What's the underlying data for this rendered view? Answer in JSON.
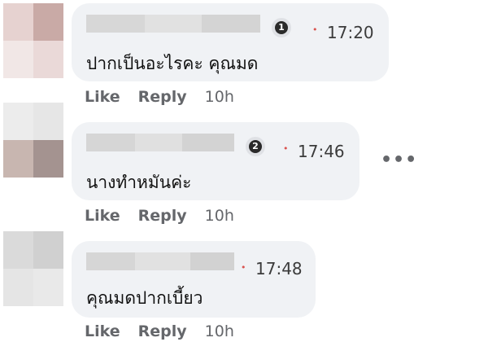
{
  "comments": [
    {
      "badge": "1",
      "time": "17:20",
      "text": "ปากเป็นอะไรคะ คุณมด",
      "like": "Like",
      "reply": "Reply",
      "age": "10h"
    },
    {
      "badge": "2",
      "time": "17:46",
      "text": "นางทำหมันค่ะ",
      "like": "Like",
      "reply": "Reply",
      "age": "10h"
    },
    {
      "time": "17:48",
      "text": "คุณมดปากเบี้ยว",
      "like": "Like",
      "reply": "Reply",
      "age": "10h"
    }
  ],
  "more_label": "•••",
  "colors": {
    "bubble": "#f0f2f5",
    "time_dot": "#d9534f",
    "action_text": "#65676b"
  }
}
